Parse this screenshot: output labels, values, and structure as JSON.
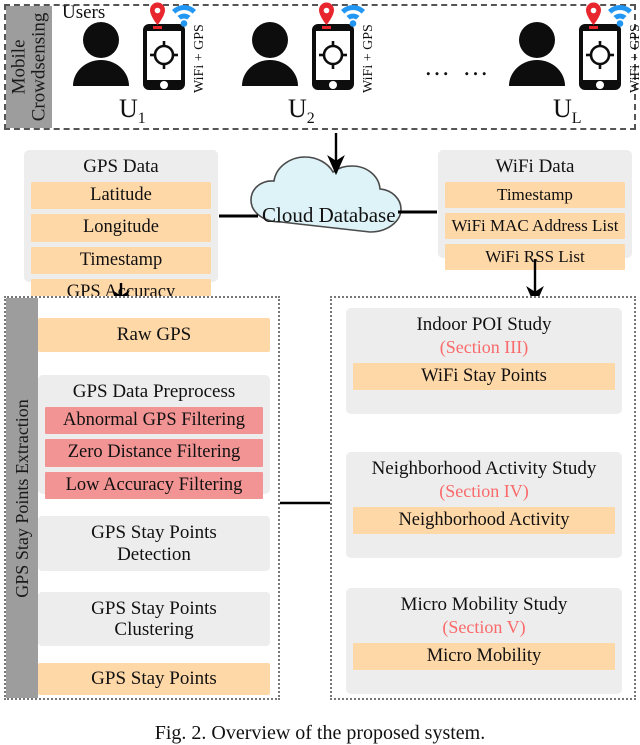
{
  "figure": {
    "caption": "Fig. 2. Overview of the proposed system."
  },
  "sections": {
    "mobile_crowdsensing": {
      "side_label_line1": "Mobile",
      "side_label_line2": "Crowdsensing",
      "users_label": "Users",
      "sensor_label": "WiFi + GPS",
      "ellipsis": "… …",
      "users": [
        {
          "name": "U",
          "index": "1"
        },
        {
          "name": "U",
          "index": "2"
        },
        {
          "name": "U",
          "index": "L"
        }
      ]
    },
    "gps_stay_points_extraction": {
      "side_label": "GPS Stay Points Extraction"
    }
  },
  "gps_data": {
    "title": "GPS Data",
    "fields": [
      "Latitude",
      "Longitude",
      "Timestamp",
      "GPS Accuracy"
    ]
  },
  "wifi_data": {
    "title": "WiFi Data",
    "fields": [
      "Timestamp",
      "WiFi MAC Address List",
      "WiFi RSS List"
    ]
  },
  "cloud": {
    "label": "Cloud Database"
  },
  "pipeline": {
    "raw_gps": "Raw GPS",
    "preprocess": {
      "title": "GPS Data Preprocess",
      "filters": [
        "Abnormal GPS Filtering",
        "Zero Distance Filtering",
        "Low Accuracy Filtering"
      ]
    },
    "detection_line1": "GPS Stay Points",
    "detection_line2": "Detection",
    "clustering_line1": "GPS Stay Points",
    "clustering_line2": "Clustering",
    "output": "GPS Stay Points"
  },
  "studies": [
    {
      "title": "Indoor POI Study",
      "section": "(Section III)",
      "output": "WiFi Stay Points"
    },
    {
      "title": "Neighborhood Activity Study",
      "section": "(Section IV)",
      "output": "Neighborhood Activity"
    },
    {
      "title": "Micro Mobility Study",
      "section": "(Section V)",
      "output": "Micro Mobility"
    }
  ],
  "colors": {
    "orange": "#ffd8a8",
    "red": "#f39494",
    "grey": "#ededed",
    "side_grey": "#9d9d9d",
    "section_red": "#fa6a6a",
    "cloud": "#ddf3f8",
    "pin_red": "#e8262d",
    "wifi_blue": "#2196f3"
  },
  "icons": {
    "person": "person-icon",
    "phone": "smartphone-gps-icon",
    "pin": "map-pin-icon",
    "wifi": "wifi-signal-icon",
    "cloud": "cloud-icon"
  }
}
